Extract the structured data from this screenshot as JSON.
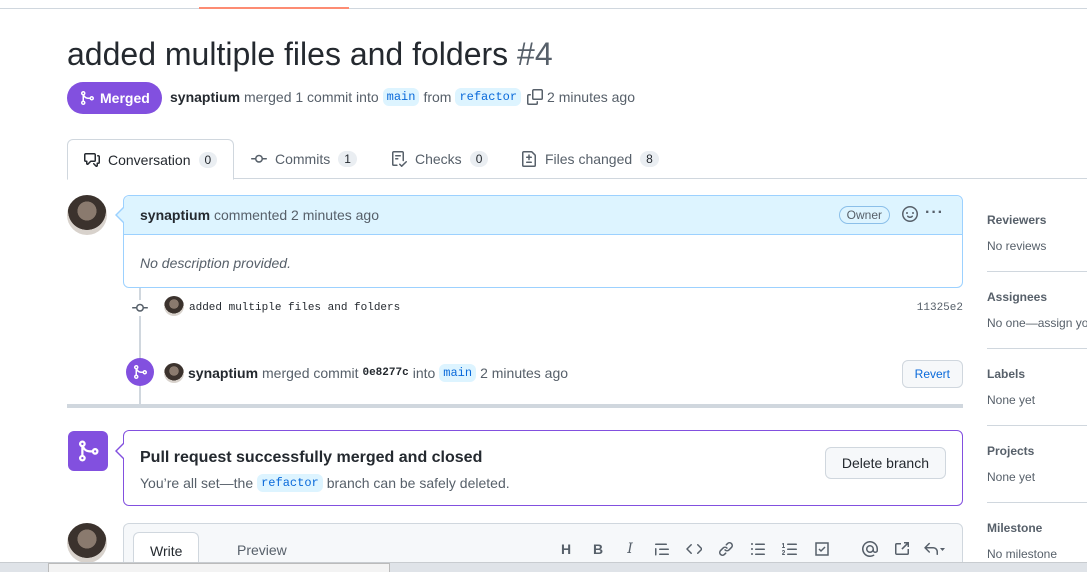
{
  "pr": {
    "title": "added multiple files and folders",
    "number": "#4",
    "state_label": "Merged",
    "author": "synaptium",
    "action_text": "merged 1 commit into",
    "base_branch": "main",
    "from_text": "from",
    "head_branch": "refactor",
    "time": "2 minutes ago"
  },
  "tabs": [
    {
      "label": "Conversation",
      "count": "0"
    },
    {
      "label": "Commits",
      "count": "1"
    },
    {
      "label": "Checks",
      "count": "0"
    },
    {
      "label": "Files changed",
      "count": "8"
    }
  ],
  "comment": {
    "author": "synaptium",
    "action": "commented 2 minutes ago",
    "role_badge": "Owner",
    "body": "No description provided."
  },
  "commit": {
    "message": "added multiple files and folders",
    "sha": "11325e2"
  },
  "merge_event": {
    "author": "synaptium",
    "text": "merged commit",
    "sha": "0e8277c",
    "into_text": "into",
    "branch": "main",
    "time": "2 minutes ago",
    "revert_label": "Revert"
  },
  "merged_box": {
    "title": "Pull request successfully merged and closed",
    "sub_prefix": "You’re all set—the",
    "branch": "refactor",
    "sub_suffix": "branch can be safely deleted.",
    "delete_label": "Delete branch"
  },
  "editor": {
    "write_tab": "Write",
    "preview_tab": "Preview",
    "heading_glyph": "H",
    "bold_glyph": "B",
    "italic_glyph": "I"
  },
  "sidebar": {
    "reviewers_title": "Reviewers",
    "reviewers_value": "No reviews",
    "assignees_title": "Assignees",
    "assignees_value": "No one—assign yo",
    "labels_title": "Labels",
    "labels_value": "None yet",
    "projects_title": "Projects",
    "projects_value": "None yet",
    "milestone_title": "Milestone",
    "milestone_value": "No milestone"
  },
  "colors": {
    "merged_purple": "#8250df",
    "comment_header_bg": "#ddf4ff",
    "link_blue": "#0969da"
  }
}
